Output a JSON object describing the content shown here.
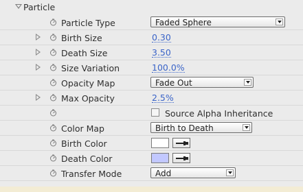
{
  "section": {
    "title": "Particle"
  },
  "rows": {
    "particle_type": {
      "label": "Particle Type",
      "value": "Faded Sphere"
    },
    "birth_size": {
      "label": "Birth Size",
      "value": "0.30"
    },
    "death_size": {
      "label": "Death Size",
      "value": "3.50"
    },
    "size_variation": {
      "label": "Size Variation",
      "value": "100.0%"
    },
    "opacity_map": {
      "label": "Opacity Map",
      "value": "Fade Out"
    },
    "max_opacity": {
      "label": "Max Opacity",
      "value": "2.5%"
    },
    "source_alpha": {
      "label": "Source Alpha Inheritance",
      "checked": false
    },
    "color_map": {
      "label": "Color Map",
      "value": "Birth to Death"
    },
    "birth_color": {
      "label": "Birth Color",
      "color": "#ffffff"
    },
    "death_color": {
      "label": "Death Color",
      "color": "#c2c8ff"
    },
    "transfer_mode": {
      "label": "Transfer Mode",
      "value": "Add"
    }
  },
  "colors": {
    "value_blue": "#3a64c8",
    "panel_bg": "#ebebeb",
    "bottom_strip": "#f3ecd4"
  },
  "icons": {
    "stopwatch": "stopwatch-icon",
    "expand": "disclosure-triangle-icon",
    "eyedropper": "eyedropper-icon"
  }
}
